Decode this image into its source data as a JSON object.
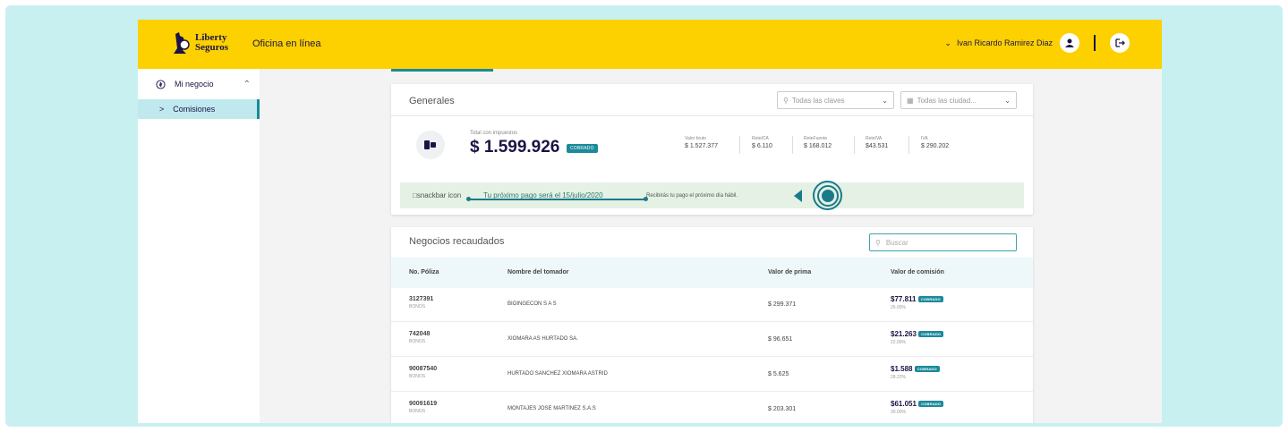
{
  "header": {
    "logo_line1": "Liberty",
    "logo_line2": "Seguros",
    "app_title": "Oficina en línea",
    "user_name": "Ivan Ricardo Ramirez Diaz"
  },
  "sidebar": {
    "items": [
      {
        "label": "Mi negocio"
      },
      {
        "label": "Comisiones"
      }
    ]
  },
  "generales": {
    "title": "Generales",
    "select_claves": "Todas las claves",
    "select_ciudad": "Todas las ciudad...",
    "total_label": "Total con impuestos",
    "total_value": "$ 1.599.926",
    "total_badge": "COBRADO",
    "metrics": [
      {
        "label": "Valor bruto",
        "value": "$ 1.527.377"
      },
      {
        "label": "ReteICA",
        "value": "$ 6.110"
      },
      {
        "label": "ReteFuente",
        "value": "$ 168.012"
      },
      {
        "label": "ReteIVA",
        "value": "$43.531"
      },
      {
        "label": "IVA",
        "value": "$ 290.202"
      }
    ]
  },
  "snackbar": {
    "img_alt": "snackbar icon",
    "date_text": "Tu próximo pago será el 15/julio/2020",
    "message": "Recibirás tu pago el próximo día hábil."
  },
  "negocios": {
    "title": "Negocios recaudados",
    "search_placeholder": "Buscar",
    "columns": [
      "No. Póliza",
      "Nombre del tomador",
      "Valor de prima",
      "Valor de comisión"
    ],
    "rows": [
      {
        "poliza": "3127391",
        "tipo": "BONOS",
        "tomador": "BIOINGECON S A S",
        "prima": "$ 299.371",
        "comision": "$77.811",
        "badge": "COBRADO",
        "pct": "26.00%"
      },
      {
        "poliza": "742048",
        "tipo": "BONOS",
        "tomador": "XIOMARA AS HURTADO SA.",
        "prima": "$ 96.651",
        "comision": "$21.263",
        "badge": "COBRADO",
        "pct": "22.00%"
      },
      {
        "poliza": "90087540",
        "tipo": "BONOS",
        "tomador": "HURTADO SANCHEZ XIOMARA ASTRID",
        "prima": "$ 5.625",
        "comision": "$1.588",
        "badge": "COBRADO",
        "pct": "28.22%"
      },
      {
        "poliza": "90091619",
        "tipo": "BONOS",
        "tomador": "MONTAJES JOSE MARTINEZ S.A.S",
        "prima": "$ 203.301",
        "comision": "$61.051",
        "badge": "COBRADO",
        "pct": "30.00%"
      }
    ]
  },
  "colors": {
    "header_yellow": "#fdd000",
    "brand_navy": "#1a1446",
    "accent_teal": "#1b8a9a",
    "snackbar_green": "#e4f1e4"
  }
}
